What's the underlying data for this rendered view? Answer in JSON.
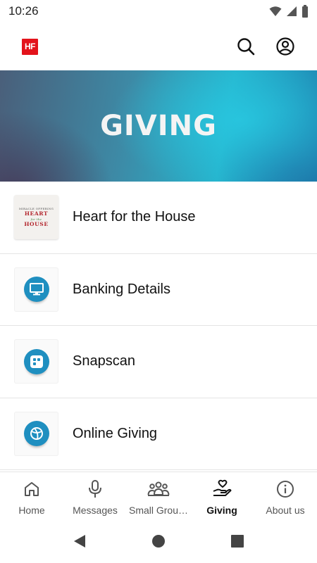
{
  "status": {
    "time": "10:26"
  },
  "app": {
    "logo_text": "HF"
  },
  "banner": {
    "title": "GIVING"
  },
  "list": {
    "items": [
      {
        "label": "Heart for the House",
        "thumb_lines": [
          "MIRACLE OFFERING",
          "HEART",
          "for the",
          "HOUSE"
        ]
      },
      {
        "label": "Banking Details",
        "icon": "monitor-icon"
      },
      {
        "label": "Snapscan",
        "icon": "snapscan-icon"
      },
      {
        "label": "Online Giving",
        "icon": "globe-icon"
      }
    ]
  },
  "nav": {
    "items": [
      {
        "label": "Home",
        "icon": "home-icon",
        "active": false
      },
      {
        "label": "Messages",
        "icon": "microphone-icon",
        "active": false
      },
      {
        "label": "Small Grou…",
        "icon": "group-icon",
        "active": false
      },
      {
        "label": "Giving",
        "icon": "giving-hand-icon",
        "active": true
      },
      {
        "label": "About us",
        "icon": "info-icon",
        "active": false
      }
    ]
  },
  "colors": {
    "accent_blue": "#1f8fc0",
    "logo_red": "#e3131b"
  }
}
